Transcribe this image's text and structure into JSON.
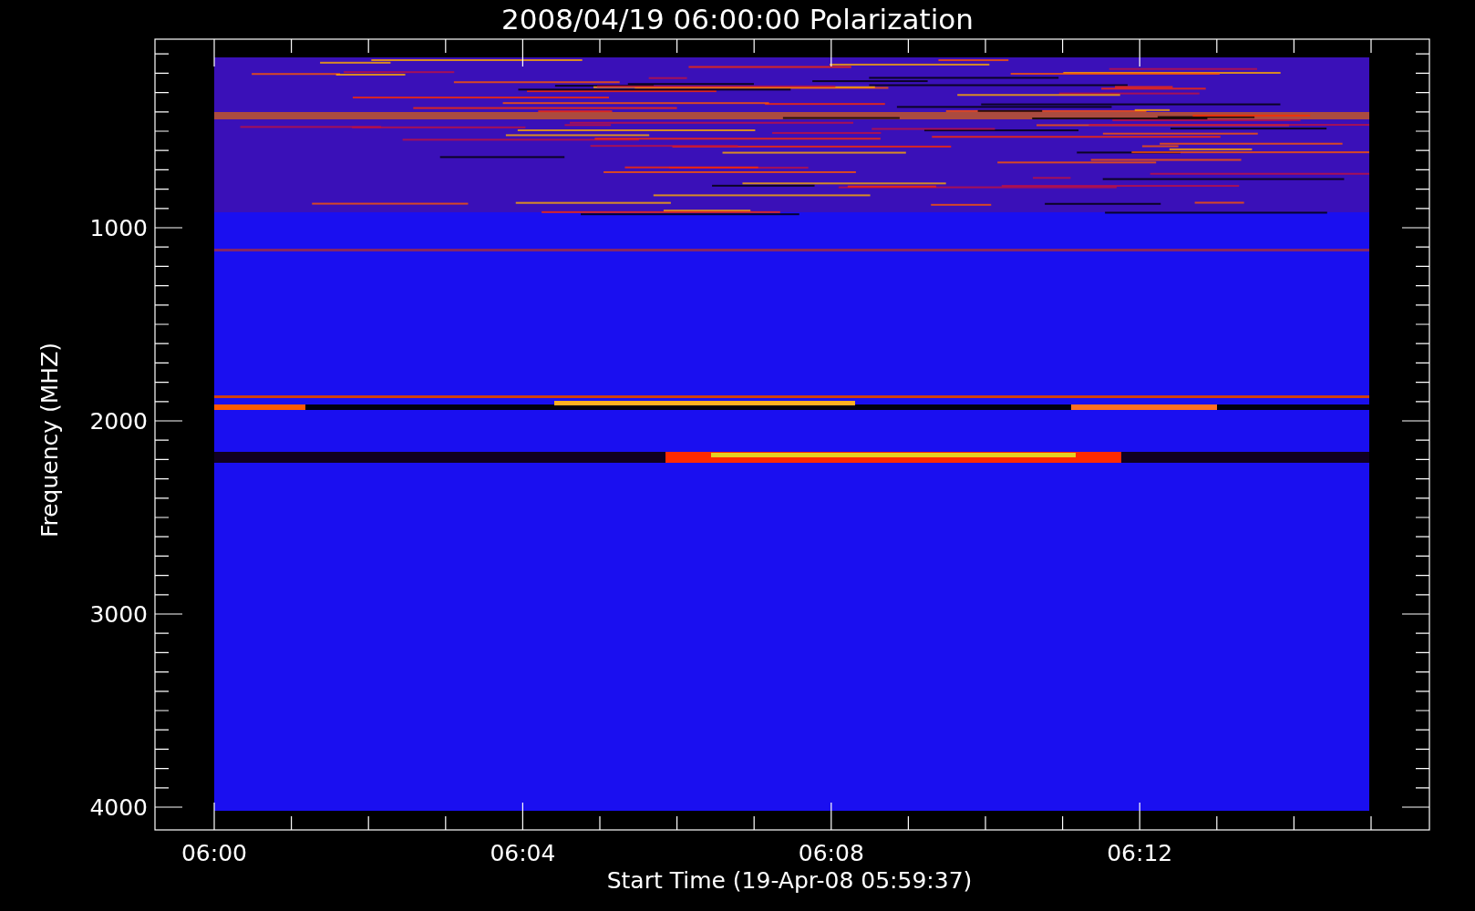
{
  "title": "2008/04/19 06:00:00 Polarization",
  "y_axis": {
    "label": "Frequency (MHZ)",
    "ticks": [
      "1000",
      "2000",
      "3000",
      "4000"
    ]
  },
  "x_axis": {
    "label": "Start Time (19-Apr-08 05:59:37)",
    "ticks": [
      "06:00",
      "06:04",
      "06:08",
      "06:12"
    ]
  }
}
